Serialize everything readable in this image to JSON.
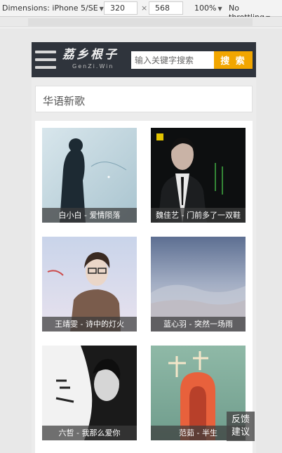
{
  "devtools": {
    "device": "Dimensions: iPhone 5/SE",
    "width": "320",
    "height": "568",
    "zoom": "100%",
    "throttling": "No throttling"
  },
  "header": {
    "logo_main": "荔乡根子",
    "logo_sub": "GenZi.Win",
    "search_placeholder": "输入关键字搜索",
    "search_button": "搜 索"
  },
  "section": {
    "title": "华语新歌"
  },
  "songs": [
    {
      "caption": "白小白 - 爱情陨落"
    },
    {
      "caption": "魏佳艺 - 门前多了一双鞋"
    },
    {
      "caption": "王靖雯 - 诗中的灯火"
    },
    {
      "caption": "蓝心羽 - 突然一场雨"
    },
    {
      "caption": "六哲 - 我那么爱你"
    },
    {
      "caption": "范茹 - 半生"
    }
  ],
  "feedback": {
    "line1": "反馈",
    "line2": "建议"
  },
  "colors": {
    "header_bg": "#2f343c",
    "search_button": "#f2a600"
  }
}
